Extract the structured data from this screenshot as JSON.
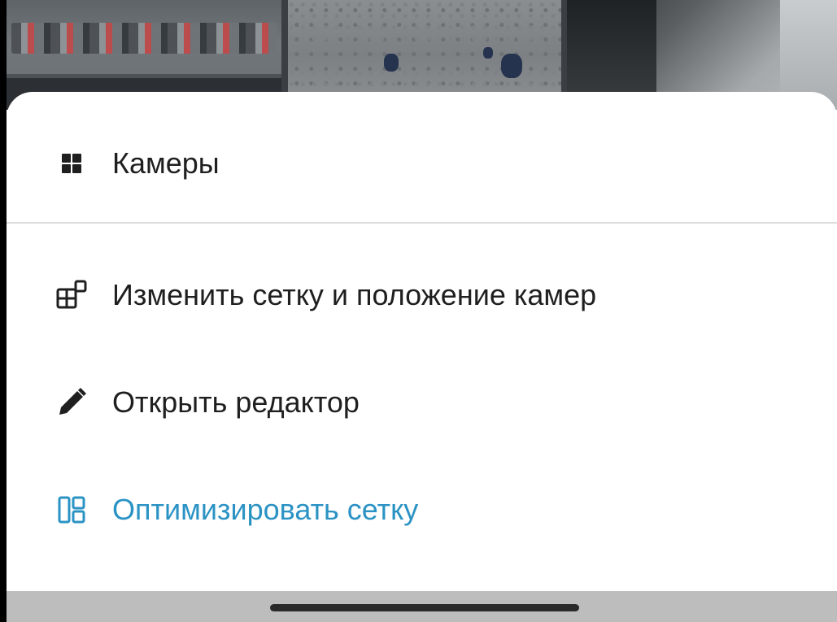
{
  "sheet": {
    "title": "Камеры",
    "title_icon": "grid-icon",
    "items": [
      {
        "label": "Изменить сетку и положение камер",
        "icon": "layout-edit-icon"
      },
      {
        "label": "Открыть редактор",
        "icon": "pencil-icon"
      },
      {
        "label": "Оптимизировать сетку",
        "icon": "layout-optimize-icon",
        "color": "#2b93c4"
      }
    ]
  },
  "colors": {
    "accent": "#2b93c4",
    "text": "#1f1f1f",
    "divider": "#dcdcdc",
    "nav_bar": "#bdbdbd"
  }
}
